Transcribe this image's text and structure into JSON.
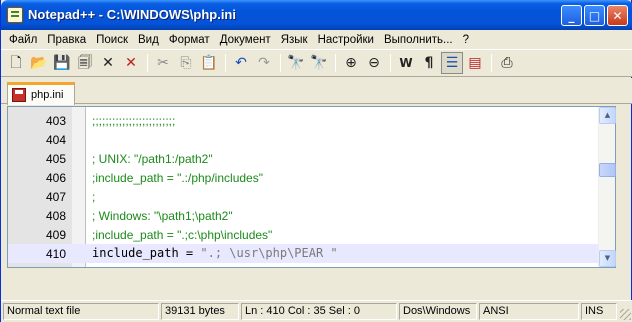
{
  "window": {
    "title": "Notepad++ - C:\\WINDOWS\\php.ini",
    "buttons": {
      "minimize": "_",
      "maximize": "□",
      "close": "✕"
    }
  },
  "menu": [
    "Файл",
    "Правка",
    "Поиск",
    "Вид",
    "Формат",
    "Документ",
    "Язык",
    "Настройки",
    "Выполнить...",
    "?"
  ],
  "toolbar": {
    "tools": [
      {
        "name": "new-file-icon",
        "glyph": "🗋"
      },
      {
        "name": "open-file-icon",
        "glyph": "📂"
      },
      {
        "name": "save-icon",
        "glyph": "💾"
      },
      {
        "name": "save-all-icon",
        "glyph": "🗐"
      },
      {
        "name": "close-icon",
        "glyph": "✕"
      },
      {
        "name": "close-all-icon",
        "glyph": "✕"
      },
      {
        "name": "cut-icon",
        "glyph": "✂"
      },
      {
        "name": "copy-icon",
        "glyph": "⎘"
      },
      {
        "name": "paste-icon",
        "glyph": "📋"
      },
      {
        "name": "undo-icon",
        "glyph": "↶"
      },
      {
        "name": "redo-icon",
        "glyph": "↷"
      },
      {
        "name": "find-icon",
        "glyph": "🔭"
      },
      {
        "name": "replace-icon",
        "glyph": "🔭"
      },
      {
        "name": "zoom-in-icon",
        "glyph": "⊕"
      },
      {
        "name": "zoom-out-icon",
        "glyph": "⊖"
      },
      {
        "name": "word-wrap-icon",
        "glyph": "W"
      },
      {
        "name": "show-all-chars-icon",
        "glyph": "¶"
      },
      {
        "name": "indent-guide-icon",
        "glyph": "☰"
      },
      {
        "name": "user-lang-icon",
        "glyph": "▤"
      },
      {
        "name": "print-icon",
        "glyph": "⎙"
      }
    ]
  },
  "tab": {
    "label": "php.ini"
  },
  "editor": {
    "lines": [
      {
        "num": "403",
        "text": ";;;;;;;;;;;;;;;;;;;;;;;;;"
      },
      {
        "num": "404",
        "text": ""
      },
      {
        "num": "405",
        "text": "; UNIX: \"/path1:/path2\""
      },
      {
        "num": "406",
        "text": ";include_path = \".:/php/includes\""
      },
      {
        "num": "407",
        "text": ";"
      },
      {
        "num": "408",
        "text": "; Windows: \"\\path1;\\path2\""
      },
      {
        "num": "409",
        "text": ";include_path = \".;c:\\php\\includes\""
      },
      {
        "num": "410",
        "text": "include_path = \".; \\usr\\php\\PEAR \""
      }
    ],
    "current_line": {
      "key": "include_path",
      "op": " = ",
      "value": "\".; \\usr\\php\\PEAR \""
    }
  },
  "status": {
    "type": "Normal text file",
    "bytes": "39131 bytes",
    "position": "Ln : 410   Col : 35   Sel : 0",
    "eol": "Dos\\Windows",
    "encoding": "ANSI",
    "mode": "INS"
  }
}
